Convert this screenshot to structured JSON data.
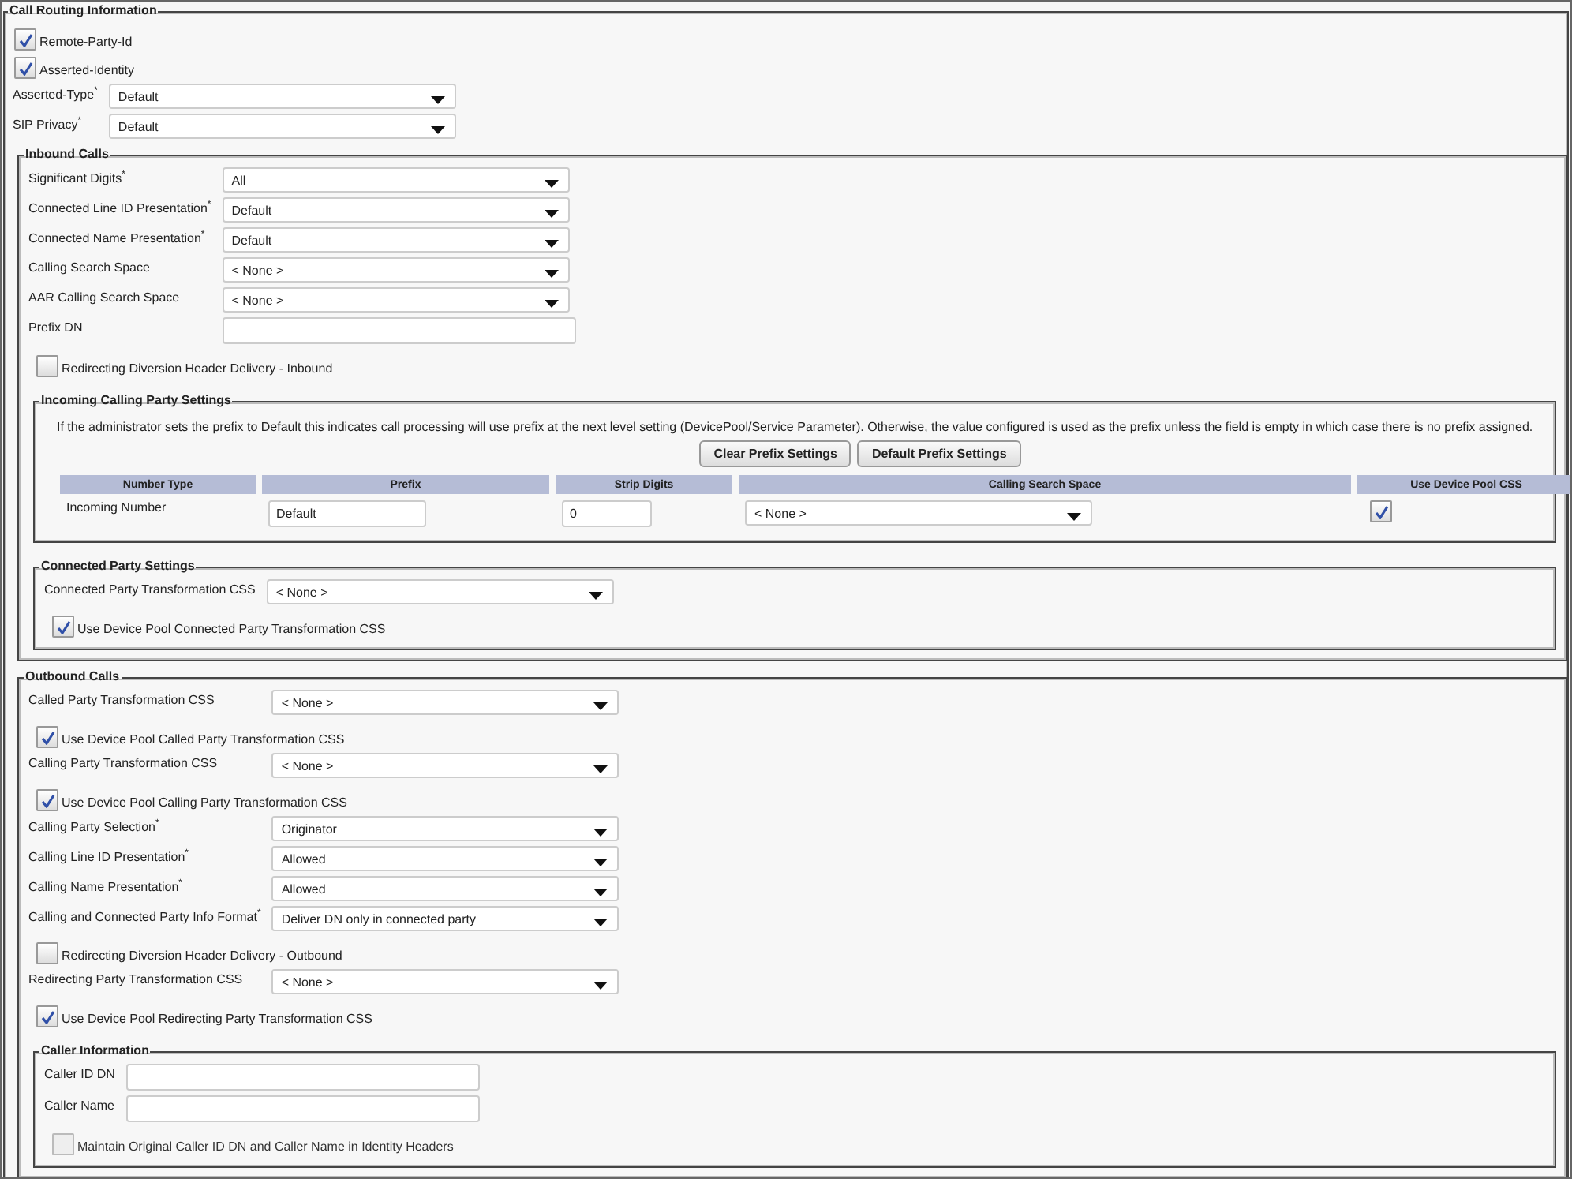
{
  "groups": [
    {
      "title": "Call Routing Information",
      "items": [
        {
          "kind": "checkbox",
          "label": "Remote-Party-Id",
          "checked": true,
          "disabled": false
        },
        {
          "kind": "checkbox",
          "label": "Asserted-Identity",
          "checked": true,
          "disabled": false
        },
        {
          "kind": "select",
          "label": "Asserted-Type$^{*}$",
          "value": "Default"
        },
        {
          "kind": "select",
          "label": "SIP Privacy$^{*}$",
          "value": "Default"
        }
      ],
      "children": [
        {
          "title": "Inbound Calls",
          "items": [
            {
              "kind": "select",
              "label": "Significant Digits$^{*}$",
              "value": "All"
            },
            {
              "kind": "select",
              "label": "Connected Line ID Presentation$^{*}$",
              "value": "Default"
            },
            {
              "kind": "select",
              "label": "Connected Name Presentation$^{*}$",
              "value": "Default"
            },
            {
              "kind": "select",
              "label": "Calling Search Space",
              "value": "< None >"
            },
            {
              "kind": "select",
              "label": "AAR Calling Search Space",
              "value": "< None >"
            },
            {
              "kind": "input",
              "label": "Prefix DN"
            },
            {
              "kind": "checkbox",
              "label": "Redirecting Diversion Header Delivery - Inbound",
              "checked": false,
              "disabled": false
            }
          ],
          "children": [
            {
              "title": "Incoming Calling Party Settings",
              "items": [
                {
                  "kind": "note",
                  "text": "If the administrator sets the prefix to Default this indicates call processing will use prefix at the next level setting (DevicePool/Service Parameter). Otherwise, the value configured is used as the prefix unless the field is empty in which case there is no prefix assigned."
                },
                {
                  "kind": "buttons",
                  "buttons": [
                    "Clear Prefix Settings",
                    "Default Prefix Settings"
                  ]
                },
                {
                  "kind": "table",
                  "columns": [
                    "Number Type",
                    "Prefix",
                    "Strip Digits",
                    "Calling Search Space",
                    "Use Device Pool CSS"
                  ],
                  "rows": [
                    [
                      {
                        "kind": "text",
                        "value": "Incoming Number"
                      },
                      {
                        "kind": "input",
                        "value": "Default"
                      },
                      {
                        "kind": "input",
                        "value": "0"
                      },
                      {
                        "kind": "select",
                        "value": "< None >"
                      },
                      {
                        "kind": "checkbox",
                        "checked": true
                      }
                    ]
                  ]
                }
              ]
            },
            {
              "title": "Connected Party Settings",
              "items": [
                {
                  "kind": "select",
                  "label": "Connected Party Transformation CSS",
                  "value": "< None >"
                },
                {
                  "kind": "checkbox",
                  "label": "Use Device Pool Connected Party Transformation CSS",
                  "checked": true,
                  "disabled": false
                }
              ]
            }
          ]
        },
        {
          "title": "Outbound Calls",
          "items": [
            {
              "kind": "select",
              "label": "Called Party Transformation CSS",
              "value": "< None >"
            },
            {
              "kind": "checkbox",
              "label": "Use Device Pool Called Party Transformation CSS",
              "checked": true,
              "disabled": false
            },
            {
              "kind": "select",
              "label": "Calling Party Transformation CSS",
              "value": "< None >"
            },
            {
              "kind": "checkbox",
              "label": "Use Device Pool Calling Party Transformation CSS",
              "checked": true,
              "disabled": false
            },
            {
              "kind": "select",
              "label": "Calling Party Selection$^{*}$",
              "value": "Originator"
            },
            {
              "kind": "select",
              "label": "Calling Line ID Presentation$^{*}$",
              "value": "Allowed"
            },
            {
              "kind": "select",
              "label": "Calling Name Presentation$^{*}$",
              "value": "Allowed"
            },
            {
              "kind": "select",
              "label": "Calling and Connected Party Info Format$^{*}$",
              "value": "Deliver DN only in connected party"
            },
            {
              "kind": "checkbox",
              "label": "Redirecting Diversion Header Delivery - Outbound",
              "checked": false,
              "disabled": false
            },
            {
              "kind": "select",
              "label": "Redirecting Party Transformation CSS",
              "value": "< None >"
            },
            {
              "kind": "checkbox",
              "label": "Use Device Pool Redirecting Party Transformation CSS",
              "checked": true,
              "disabled": false
            }
          ],
          "children": [
            {
              "title": "Caller Information",
              "items": [
                {
                  "kind": "input",
                  "label": "Caller ID DN"
                },
                {
                  "kind": "input",
                  "label": "Caller Name"
                },
                {
                  "kind": "checkbox",
                  "label": "Maintain Original Caller ID DN and Caller Name in Identity Headers",
                  "checked": false,
                  "disabled": true
                }
              ]
            }
          ]
        }
      ]
    }
  ]
}
